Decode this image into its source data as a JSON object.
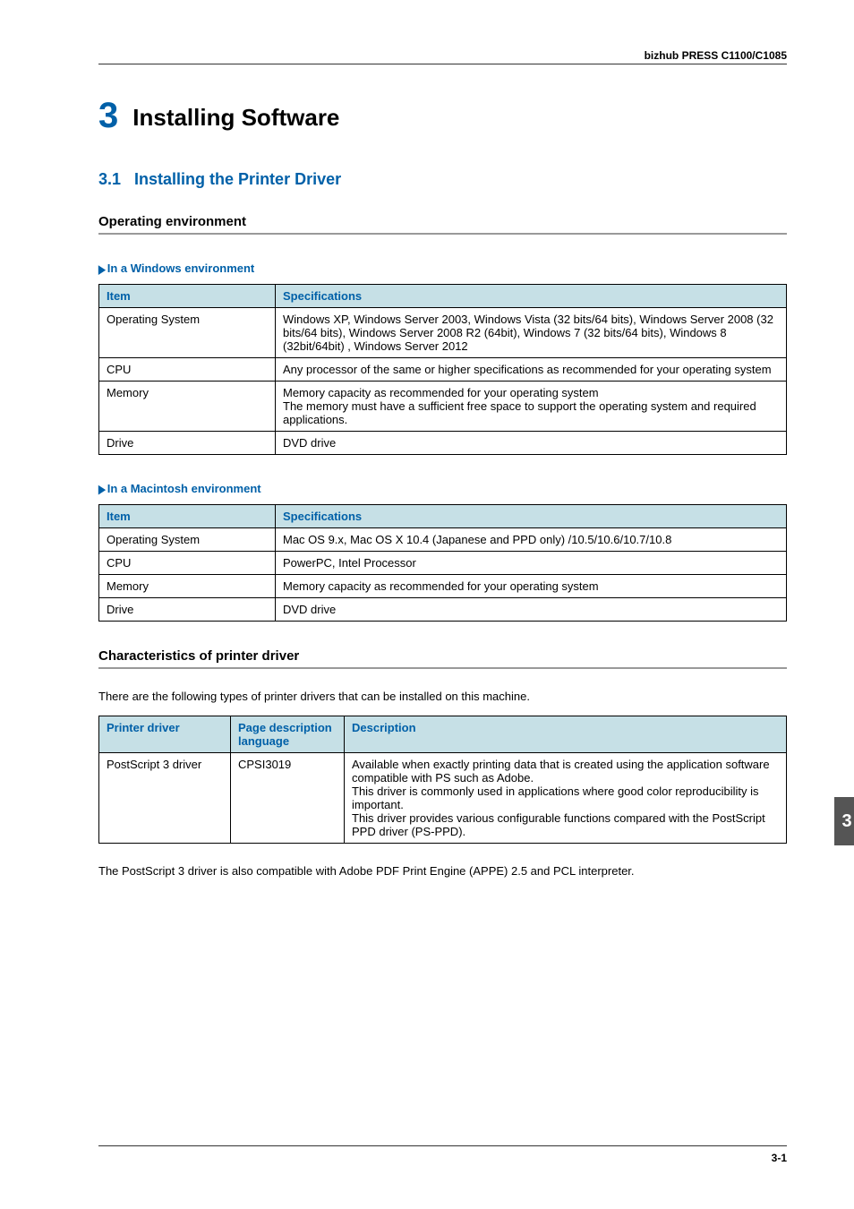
{
  "meta": {
    "product": "bizhub PRESS C1100/C1085"
  },
  "chapter": {
    "number": "3",
    "title": "Installing Software"
  },
  "section": {
    "number": "3.1",
    "title": "Installing the Printer Driver"
  },
  "operating_env": {
    "heading": "Operating environment",
    "windows": {
      "label": "In a Windows environment",
      "headers": {
        "item": "Item",
        "spec": "Specifications"
      },
      "rows": [
        {
          "item": "Operating System",
          "spec": "Windows XP, Windows Server 2003, Windows Vista (32 bits/64 bits), Windows Server 2008 (32 bits/64 bits), Windows Server 2008 R2 (64bit), Windows 7 (32 bits/64 bits), Windows 8 (32bit/64bit) , Windows Server 2012"
        },
        {
          "item": "CPU",
          "spec": "Any processor of the same or higher specifications as recommended for your operating system"
        },
        {
          "item": "Memory",
          "spec": "Memory capacity as recommended for your operating system\nThe memory must have a sufficient free space to support the operating system and required applications."
        },
        {
          "item": "Drive",
          "spec": "DVD drive"
        }
      ]
    },
    "mac": {
      "label": "In a Macintosh environment",
      "headers": {
        "item": "Item",
        "spec": "Specifications"
      },
      "rows": [
        {
          "item": "Operating System",
          "spec": "Mac OS 9.x, Mac OS X 10.4 (Japanese and PPD only) /10.5/10.6/10.7/10.8"
        },
        {
          "item": "CPU",
          "spec": "PowerPC, Intel Processor"
        },
        {
          "item": "Memory",
          "spec": "Memory capacity as recommended for your operating system"
        },
        {
          "item": "Drive",
          "spec": "DVD drive"
        }
      ]
    }
  },
  "driver_chars": {
    "heading": "Characteristics of printer driver",
    "intro": "There are the following types of printer drivers that can be installed on this machine.",
    "headers": {
      "driver": "Printer driver",
      "lang": "Page description language",
      "desc": "Description"
    },
    "rows": [
      {
        "driver": "PostScript 3 driver",
        "lang": "CPSI3019",
        "desc": "Available when exactly printing data that is created using the application software compatible with PS such as Adobe.\nThis driver is commonly used in applications where good color reproducibility is important.\nThis driver provides various configurable functions compared with the PostScript PPD driver (PS-PPD)."
      }
    ],
    "note": "The PostScript 3 driver is also compatible with Adobe PDF Print Engine (APPE) 2.5 and PCL interpreter."
  },
  "tab": "3",
  "page_no": "3-1"
}
